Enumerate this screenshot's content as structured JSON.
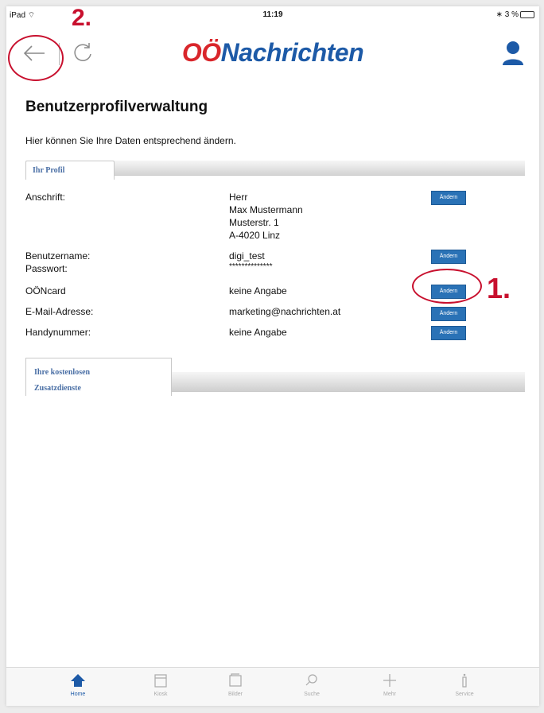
{
  "status_bar": {
    "device": "iPad",
    "time": "11:19",
    "battery": "3 %"
  },
  "nav": {
    "logo_oo": "OÖ",
    "logo_rest": "Nachrichten"
  },
  "annotations": {
    "step1": "1.",
    "step2": "2."
  },
  "page": {
    "title": "Benutzerprofilverwaltung",
    "subtitle": "Hier können Sie Ihre Daten entsprechend ändern.",
    "tab_profile": "Ihr Profil",
    "tab_services_line1": "Ihre kostenlosen",
    "tab_services_line2": "Zusatzdienste"
  },
  "profile": {
    "address_label": "Anschrift:",
    "address_lines": [
      "Herr",
      "Max Mustermann",
      "Musterstr. 1",
      "A-4020 Linz"
    ],
    "username_label": "Benutzername:",
    "password_label": "Passwort:",
    "username_value": "digi_test",
    "password_value": "**************",
    "card_label": "OÖNcard",
    "card_value": "keine Angabe",
    "email_label": "E-Mail-Adresse:",
    "email_value": "marketing@nachrichten.at",
    "phone_label": "Handynummer:",
    "phone_value": "keine Angabe",
    "change_label": "Ändern"
  },
  "tabbar": [
    "Home",
    "Kiosk",
    "Bilder",
    "Suche",
    "Mehr",
    "Service"
  ],
  "colors": {
    "brand_blue": "#1d5aa7",
    "brand_red": "#d9262b",
    "button_blue": "#2a72b6",
    "annotation_red": "#c8102e"
  }
}
